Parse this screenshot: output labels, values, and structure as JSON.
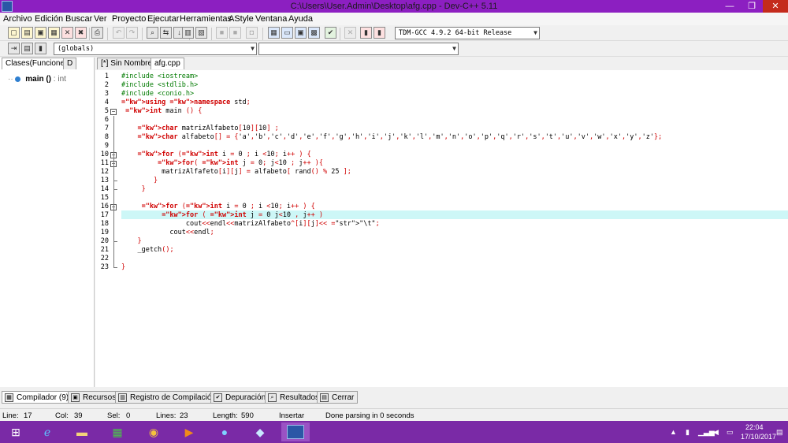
{
  "window": {
    "title": "C:\\Users\\User.Admin\\Desktop\\afg.cpp - Dev-C++ 5.11",
    "minimize": "—",
    "restore": "❐",
    "close": "✕"
  },
  "menu": [
    "Archivo",
    "Edición",
    "Buscar",
    "Ver",
    "Proyecto",
    "Ejecutar",
    "Herramientas",
    "AStyle",
    "Ventana",
    "Ayuda"
  ],
  "toolbar": {
    "compiler_select": "TDM-GCC 4.9.2 64-bit Release",
    "scope_select": "(globals)",
    "member_select": ""
  },
  "left_panel": {
    "tabs": [
      "Clases(Funciones)",
      "D"
    ],
    "tree": [
      {
        "name": "main ()",
        "type": ": int"
      }
    ]
  },
  "editor": {
    "tabs": [
      "[*] Sin Nombre3",
      "afg.cpp"
    ],
    "active_tab": "afg.cpp",
    "current_line": 17,
    "lines": [
      "#include <iostream>",
      "#include <stdlib.h>",
      "#include <conio.h>",
      "using namespace std;",
      " int main () {",
      "",
      "    char matrizAlfabeto[10][10] ;",
      "    char alfabeto[] = {'a','b','c','d','e','f','g','h','i','j','k','l','m','n','o','p','q','r','s','t','u','v','w','x','y','z'};",
      "",
      "    for (int i = 0 ; i <10; i++ ) {",
      "         for( int j = 0; j<10 ; j++ ){",
      "          matrizAlfafeto[i][j] = alfabeto[ rand() % 25 ];",
      "        }",
      "     }",
      "",
      "     for (int i = 0 ; i <10; i++ ) {",
      "          for ( int j = 0 j<10 , j++ )",
      "                cout<<endl<<matrizAlfabeto^[i][j]<< \"\\t\";",
      "            cout<<endl;",
      "    }",
      "    _getch();",
      "",
      "}"
    ]
  },
  "bottom_tabs": [
    {
      "label": "Compilador (9)",
      "icon": "compiler-icon"
    },
    {
      "label": "Recursos",
      "icon": "resources-icon"
    },
    {
      "label": "Registro de Compilación",
      "icon": "log-icon"
    },
    {
      "label": "Depuración",
      "icon": "debug-icon"
    },
    {
      "label": "Resultados",
      "icon": "results-icon"
    },
    {
      "label": "Cerrar",
      "icon": "close-panel-icon"
    }
  ],
  "status": {
    "line_label": "Line:",
    "line": "17",
    "col_label": "Col:",
    "col": "39",
    "sel_label": "Sel:",
    "sel": "0",
    "lines_label": "Lines:",
    "lines": "23",
    "length_label": "Length:",
    "length": "590",
    "mode": "Insertar",
    "message": "Done parsing in 0 seconds"
  },
  "taskbar": {
    "time": "22:04",
    "date": "17/10/2017"
  },
  "colors": {
    "titlebar": "#8c1fc1",
    "taskbar": "#7a2aa6",
    "current_line": "#cdf7f7",
    "preprocessor": "#007a00",
    "operator": "#d00000",
    "string": "#0000cc"
  }
}
